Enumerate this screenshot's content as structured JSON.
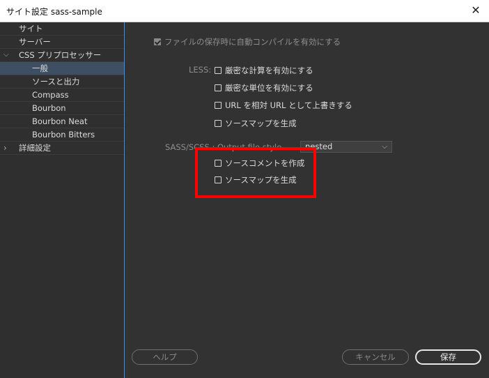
{
  "window": {
    "title": "サイト設定 sass-sample",
    "close_glyph": "✕"
  },
  "sidebar": {
    "items": [
      {
        "label": "サイト"
      },
      {
        "label": "サーバー"
      },
      {
        "label": "CSS プリプロセッサー",
        "chevron": "⌵"
      },
      {
        "label": "一般"
      },
      {
        "label": "ソースと出力"
      },
      {
        "label": "Compass"
      },
      {
        "label": "Bourbon"
      },
      {
        "label": "Bourbon Neat"
      },
      {
        "label": "Bourbon Bitters"
      },
      {
        "label": "詳細設定",
        "chevron": "›"
      }
    ]
  },
  "main": {
    "auto_compile": {
      "label": "ファイルの保存時に自動コンパイルを有効にする",
      "checked": true
    },
    "less": {
      "section_label": "LESS:",
      "options": [
        {
          "label": "厳密な計算を有効にする",
          "checked": false
        },
        {
          "label": "厳密な単位を有効にする",
          "checked": false
        },
        {
          "label": "URL を相対 URL として上書きする",
          "checked": false
        },
        {
          "label": "ソースマップを生成",
          "checked": false
        }
      ]
    },
    "sass": {
      "section_label": "SASS/SCSS : Output file style",
      "output_style": "nested",
      "options": [
        {
          "label": "ソースコメントを作成",
          "checked": false
        },
        {
          "label": "ソースマップを生成",
          "checked": false
        }
      ]
    }
  },
  "footer": {
    "help_label": "ヘルプ",
    "cancel_label": "キャンセル",
    "save_label": "保存"
  },
  "colors": {
    "background": "#323232",
    "sidebar_selected": "#3e4e63",
    "highlight": "#ff0000"
  }
}
